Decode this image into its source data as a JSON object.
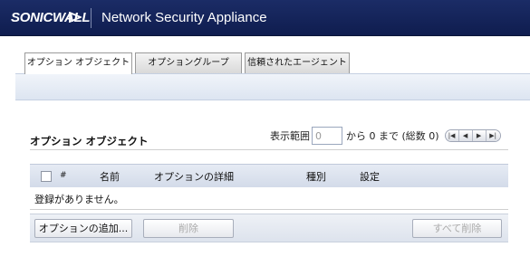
{
  "header": {
    "logo_text": "SONICWALL",
    "app_name": "Network Security Appliance",
    "bg_color": "#13235a"
  },
  "tabs": [
    {
      "label": "オプション オブジェクト",
      "active": true
    },
    {
      "label": "オプショングループ",
      "active": false
    },
    {
      "label": "信頼されたエージェント",
      "active": false
    }
  ],
  "section": {
    "title": "オプション オブジェクト"
  },
  "range": {
    "prefix": "表示範囲",
    "input_value": "0",
    "suffix": "から 0 まで (総数 0)",
    "pager_icons": [
      "first-page-icon",
      "prev-page-icon",
      "next-page-icon",
      "last-page-icon"
    ]
  },
  "table": {
    "columns": [
      "#",
      "名前",
      "オプションの詳細",
      "種別",
      "設定"
    ],
    "empty_message": "登録がありません。"
  },
  "buttons": {
    "add": "オプションの追加...",
    "delete": "削除",
    "delete_all": "すべて削除"
  }
}
